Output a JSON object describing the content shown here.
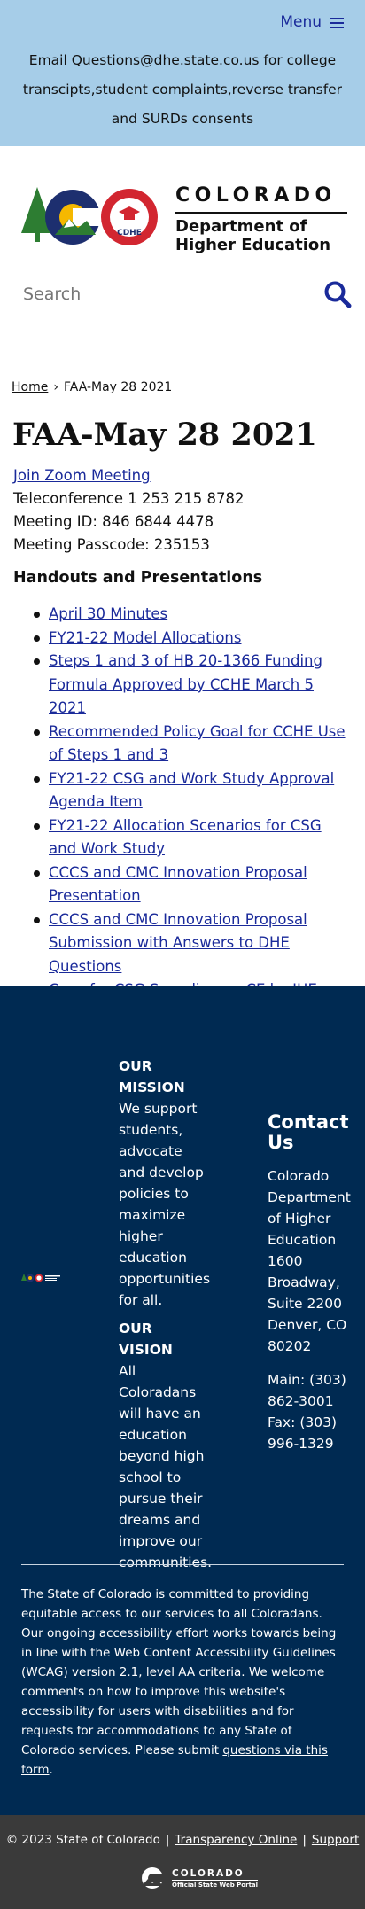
{
  "header": {
    "menu_label": "Menu",
    "notice_prefix": "Email ",
    "notice_email": "Questions@dhe.state.co.us",
    "notice_suffix": " for college transcipts,student complaints,reverse transfer and SURDs consents"
  },
  "logo": {
    "state": "COLORADO",
    "dept_line1": "Department of",
    "dept_line2": "Higher Education",
    "badge_text": "CDHE",
    "colors": {
      "blue": "#1d2f6f",
      "red": "#d22630",
      "gold": "#f5b800",
      "green": "#2d7d32"
    }
  },
  "search": {
    "placeholder": "Search"
  },
  "breadcrumb": {
    "home": "Home",
    "separator": "›",
    "current": "FAA-May 28 2021"
  },
  "page_title": "FAA-May 28 2021",
  "meeting": {
    "zoom_link": "Join Zoom Meeting",
    "teleconference": "Teleconference 1 253 215 8782",
    "meeting_id": "Meeting ID: 846 6844 4478",
    "passcode": "Meeting Passcode: 235153"
  },
  "handouts": {
    "title": "Handouts and Presentations",
    "items": [
      "April 30 Minutes",
      "FY21-22 Model Allocations",
      "Steps 1 and 3 of HB 20-1366 Funding Formula Approved by CCHE March 5 2021",
      "Recommended Policy Goal for CCHE Use of Steps 1 and 3",
      "FY21-22 CSG and Work Study Approval Agenda Item",
      "FY21-22 Allocation Scenarios for CSG and Work Study",
      "CCCS and CMC Innovation Proposal Presentation",
      "CCCS and CMC Innovation Proposal Submission with Answers to DHE Questions",
      "Caps for CSG Spending on CE by IHE"
    ]
  },
  "footer": {
    "bg_color": "#002a52",
    "mission_title": "OUR MISSION",
    "mission_text": "We support students, advocate and develop policies to maximize higher education opportunities for all.",
    "vision_title": "OUR VISION",
    "vision_text": "All Coloradans will have an education beyond high school to pursue their dreams and improve our communities.",
    "contact_title": "Contact Us",
    "address_1": "Colorado Department of Higher Education",
    "address_2": "1600 Broadway, Suite 2200",
    "address_3": "Denver, CO 80202",
    "phone_main": "Main: (303) 862-3001",
    "phone_fax": "Fax: (303) 996-1329",
    "accessibility_text": "The State of Colorado is committed to providing equitable access to our services to all Coloradans. Our ongoing accessibility effort works towards being in line with the Web Content Accessibility Guidelines (WCAG) version 2.1, level AA criteria. We welcome comments on how to improve this website's accessibility for users with disabilities and for requests for accommodations to any State of Colorado services. Please submit ",
    "accessibility_link": "questions via this form",
    "accessibility_end": "."
  },
  "bottom": {
    "copyright": "© 2023 State of Colorado",
    "divider": "|",
    "transparency": "Transparency Online",
    "support": "Support",
    "portal_state": "COLORADO",
    "portal_sub": "Official State Web Portal"
  }
}
